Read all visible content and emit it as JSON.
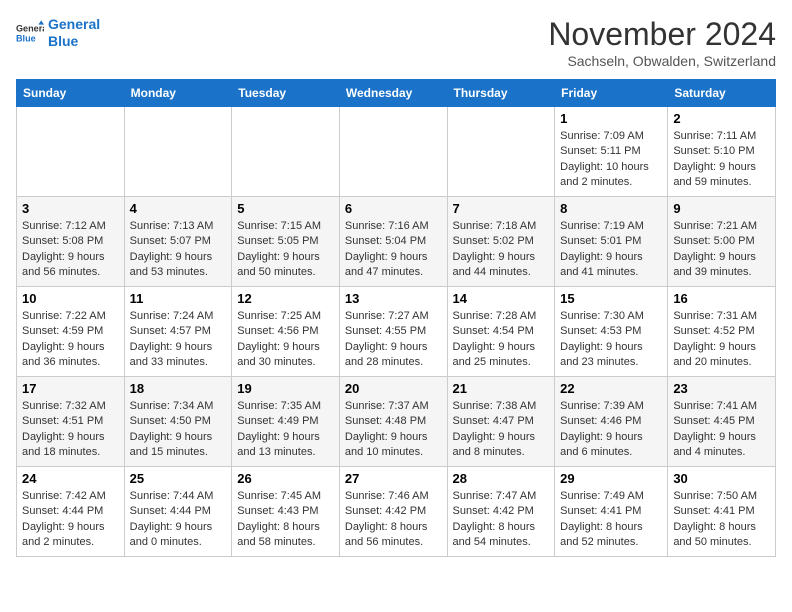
{
  "header": {
    "logo_line1": "General",
    "logo_line2": "Blue",
    "month": "November 2024",
    "location": "Sachseln, Obwalden, Switzerland"
  },
  "weekdays": [
    "Sunday",
    "Monday",
    "Tuesday",
    "Wednesday",
    "Thursday",
    "Friday",
    "Saturday"
  ],
  "weeks": [
    [
      {
        "day": "",
        "info": ""
      },
      {
        "day": "",
        "info": ""
      },
      {
        "day": "",
        "info": ""
      },
      {
        "day": "",
        "info": ""
      },
      {
        "day": "",
        "info": ""
      },
      {
        "day": "1",
        "info": "Sunrise: 7:09 AM\nSunset: 5:11 PM\nDaylight: 10 hours\nand 2 minutes."
      },
      {
        "day": "2",
        "info": "Sunrise: 7:11 AM\nSunset: 5:10 PM\nDaylight: 9 hours\nand 59 minutes."
      }
    ],
    [
      {
        "day": "3",
        "info": "Sunrise: 7:12 AM\nSunset: 5:08 PM\nDaylight: 9 hours\nand 56 minutes."
      },
      {
        "day": "4",
        "info": "Sunrise: 7:13 AM\nSunset: 5:07 PM\nDaylight: 9 hours\nand 53 minutes."
      },
      {
        "day": "5",
        "info": "Sunrise: 7:15 AM\nSunset: 5:05 PM\nDaylight: 9 hours\nand 50 minutes."
      },
      {
        "day": "6",
        "info": "Sunrise: 7:16 AM\nSunset: 5:04 PM\nDaylight: 9 hours\nand 47 minutes."
      },
      {
        "day": "7",
        "info": "Sunrise: 7:18 AM\nSunset: 5:02 PM\nDaylight: 9 hours\nand 44 minutes."
      },
      {
        "day": "8",
        "info": "Sunrise: 7:19 AM\nSunset: 5:01 PM\nDaylight: 9 hours\nand 41 minutes."
      },
      {
        "day": "9",
        "info": "Sunrise: 7:21 AM\nSunset: 5:00 PM\nDaylight: 9 hours\nand 39 minutes."
      }
    ],
    [
      {
        "day": "10",
        "info": "Sunrise: 7:22 AM\nSunset: 4:59 PM\nDaylight: 9 hours\nand 36 minutes."
      },
      {
        "day": "11",
        "info": "Sunrise: 7:24 AM\nSunset: 4:57 PM\nDaylight: 9 hours\nand 33 minutes."
      },
      {
        "day": "12",
        "info": "Sunrise: 7:25 AM\nSunset: 4:56 PM\nDaylight: 9 hours\nand 30 minutes."
      },
      {
        "day": "13",
        "info": "Sunrise: 7:27 AM\nSunset: 4:55 PM\nDaylight: 9 hours\nand 28 minutes."
      },
      {
        "day": "14",
        "info": "Sunrise: 7:28 AM\nSunset: 4:54 PM\nDaylight: 9 hours\nand 25 minutes."
      },
      {
        "day": "15",
        "info": "Sunrise: 7:30 AM\nSunset: 4:53 PM\nDaylight: 9 hours\nand 23 minutes."
      },
      {
        "day": "16",
        "info": "Sunrise: 7:31 AM\nSunset: 4:52 PM\nDaylight: 9 hours\nand 20 minutes."
      }
    ],
    [
      {
        "day": "17",
        "info": "Sunrise: 7:32 AM\nSunset: 4:51 PM\nDaylight: 9 hours\nand 18 minutes."
      },
      {
        "day": "18",
        "info": "Sunrise: 7:34 AM\nSunset: 4:50 PM\nDaylight: 9 hours\nand 15 minutes."
      },
      {
        "day": "19",
        "info": "Sunrise: 7:35 AM\nSunset: 4:49 PM\nDaylight: 9 hours\nand 13 minutes."
      },
      {
        "day": "20",
        "info": "Sunrise: 7:37 AM\nSunset: 4:48 PM\nDaylight: 9 hours\nand 10 minutes."
      },
      {
        "day": "21",
        "info": "Sunrise: 7:38 AM\nSunset: 4:47 PM\nDaylight: 9 hours\nand 8 minutes."
      },
      {
        "day": "22",
        "info": "Sunrise: 7:39 AM\nSunset: 4:46 PM\nDaylight: 9 hours\nand 6 minutes."
      },
      {
        "day": "23",
        "info": "Sunrise: 7:41 AM\nSunset: 4:45 PM\nDaylight: 9 hours\nand 4 minutes."
      }
    ],
    [
      {
        "day": "24",
        "info": "Sunrise: 7:42 AM\nSunset: 4:44 PM\nDaylight: 9 hours\nand 2 minutes."
      },
      {
        "day": "25",
        "info": "Sunrise: 7:44 AM\nSunset: 4:44 PM\nDaylight: 9 hours\nand 0 minutes."
      },
      {
        "day": "26",
        "info": "Sunrise: 7:45 AM\nSunset: 4:43 PM\nDaylight: 8 hours\nand 58 minutes."
      },
      {
        "day": "27",
        "info": "Sunrise: 7:46 AM\nSunset: 4:42 PM\nDaylight: 8 hours\nand 56 minutes."
      },
      {
        "day": "28",
        "info": "Sunrise: 7:47 AM\nSunset: 4:42 PM\nDaylight: 8 hours\nand 54 minutes."
      },
      {
        "day": "29",
        "info": "Sunrise: 7:49 AM\nSunset: 4:41 PM\nDaylight: 8 hours\nand 52 minutes."
      },
      {
        "day": "30",
        "info": "Sunrise: 7:50 AM\nSunset: 4:41 PM\nDaylight: 8 hours\nand 50 minutes."
      }
    ]
  ]
}
